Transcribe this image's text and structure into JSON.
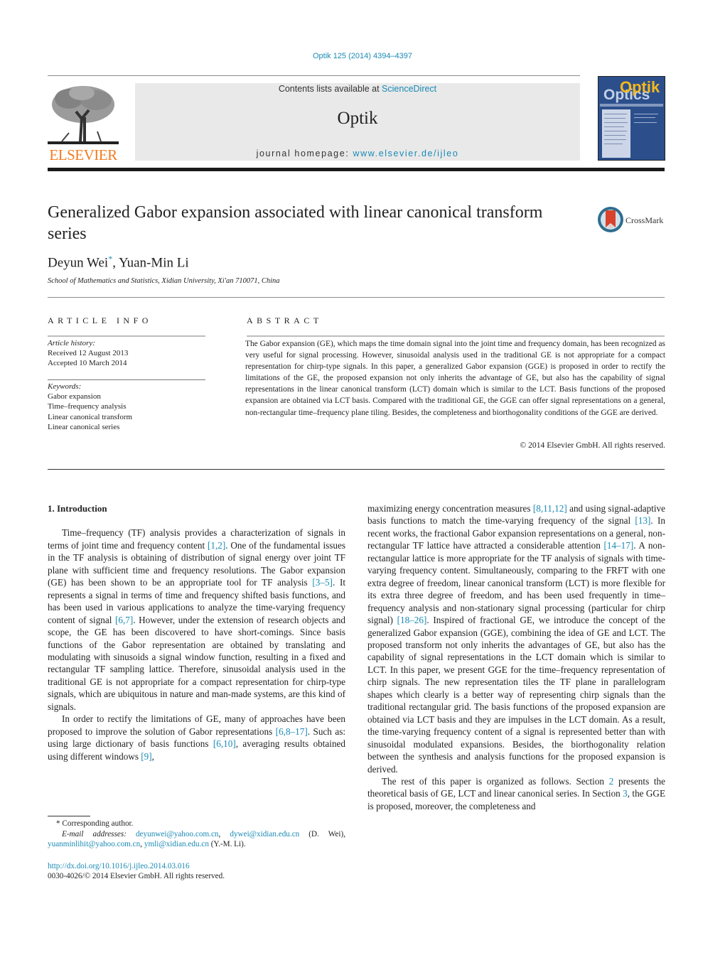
{
  "journal_ref": "Optik 125 (2014) 4394–4397",
  "header": {
    "publisher_logo_text": "ELSEVIER",
    "contents_prefix": "Contents lists available at ",
    "contents_link": "ScienceDirect",
    "journal_name": "Optik",
    "homepage_prefix": "journal homepage: ",
    "homepage_link": "www.elsevier.de/ijleo",
    "cover_title_1": "Optik",
    "cover_title_2": "Optics"
  },
  "article": {
    "title": "Generalized Gabor expansion associated with linear canonical transform series",
    "crossmark_label": "CrossMark",
    "authors": [
      {
        "name": "Deyun Wei",
        "mark": "*"
      },
      {
        "name": "Yuan-Min Li",
        "mark": ""
      }
    ],
    "author_separator": ", ",
    "affiliation": "School of Mathematics and Statistics, Xidian University, Xi'an 710071, China"
  },
  "article_info": {
    "label": "ARTICLE INFO",
    "history_label": "Article history:",
    "received": "Received 12 August 2013",
    "accepted": "Accepted 10 March 2014",
    "keywords_label": "Keywords:",
    "keywords": [
      "Gabor expansion",
      "Time–frequency analysis",
      "Linear canonical transform",
      "Linear canonical series"
    ]
  },
  "abstract": {
    "label": "ABSTRACT",
    "text": "The Gabor expansion (GE), which maps the time domain signal into the joint time and frequency domain, has been recognized as very useful for signal processing. However, sinusoidal analysis used in the traditional GE is not appropriate for a compact representation for chirp-type signals. In this paper, a generalized Gabor expansion (GGE) is proposed in order to rectify the limitations of the GE, the proposed expansion not only inherits the advantage of GE, but also has the capability of signal representations in the linear canonical transform (LCT) domain which is similar to the LCT. Basis functions of the proposed expansion are obtained via LCT basis. Compared with the traditional GE, the GGE can offer signal representations on a general, non-rectangular time–frequency plane tiling. Besides, the completeness and biorthogonality conditions of the GGE are derived.",
    "copyright": "© 2014 Elsevier GmbH. All rights reserved."
  },
  "body": {
    "section_heading": "1.  Introduction",
    "left_paragraphs": [
      [
        {
          "t": "Time–frequency (TF) analysis provides a characterization of signals in terms of joint time and frequency content "
        },
        {
          "ref": "[1,2]"
        },
        {
          "t": ". One of the fundamental issues in the TF analysis is obtaining of distribution of signal energy over joint TF plane with sufficient time and frequency resolutions. The Gabor expansion (GE) has been shown to be an appropriate tool for TF analysis "
        },
        {
          "ref": "[3–5]"
        },
        {
          "t": ". It represents a signal in terms of time and frequency shifted basis functions, and has been used in various applications to analyze the time-varying frequency content of signal "
        },
        {
          "ref": "[6,7]"
        },
        {
          "t": ". However, under the extension of research objects and scope, the GE has been discovered to have short-comings. Since basis functions of the Gabor representation are obtained by translating and modulating with sinusoids a signal window function, resulting in a fixed and rectangular TF sampling lattice. Therefore, sinusoidal analysis used in the traditional GE is not appropriate for a compact representation for chirp-type signals, which are ubiquitous in nature and man-made systems, are this kind of signals."
        }
      ],
      [
        {
          "t": "In order to rectify the limitations of GE, many of approaches have been proposed to improve the solution of Gabor representations "
        },
        {
          "ref": "[6,8–17]"
        },
        {
          "t": ". Such as: using large dictionary of basis functions "
        },
        {
          "ref": "[6,10]"
        },
        {
          "t": ", averaging results obtained using different windows "
        },
        {
          "ref": "[9]"
        },
        {
          "t": ","
        }
      ]
    ],
    "right_paragraphs": [
      [
        {
          "t": "maximizing energy concentration measures "
        },
        {
          "ref": "[8,11,12]"
        },
        {
          "t": " and using signal-adaptive basis functions to match the time-varying frequency of the signal "
        },
        {
          "ref": "[13]"
        },
        {
          "t": ". In recent works, the fractional Gabor expansion representations on a general, non-rectangular TF lattice have attracted a considerable attention "
        },
        {
          "ref": "[14–17]"
        },
        {
          "t": ". A non-rectangular lattice is more appropriate for the TF analysis of signals with time-varying frequency content. Simultaneously, comparing to the FRFT with one extra degree of freedom, linear canonical transform (LCT) is more flexible for its extra three degree of freedom, and has been used frequently in time–frequency analysis and non-stationary signal processing (particular for chirp signal) "
        },
        {
          "ref": "[18–26]"
        },
        {
          "t": ". Inspired of fractional GE, we introduce the concept of the generalized Gabor expansion (GGE), combining the idea of GE and LCT. The proposed transform not only inherits the advantages of GE, but also has the capability of signal representations in the LCT domain which is similar to LCT. In this paper, we present GGE for the time–frequency representation of chirp signals. The new representation tiles the TF plane in parallelogram shapes which clearly is a better way of representing chirp signals than the traditional rectangular grid. The basis functions of the proposed expansion are obtained via LCT basis and they are impulses in the LCT domain. As a result, the time-varying frequency content of a signal is represented better than with sinusoidal modulated expansions. Besides, the biorthogonality relation between the synthesis and analysis functions for the proposed expansion is derived."
        }
      ],
      [
        {
          "t": "The rest of this paper is organized as follows. Section "
        },
        {
          "ref": "2"
        },
        {
          "t": " presents the theoretical basis of GE, LCT and linear canonical series. In Section "
        },
        {
          "ref": "3"
        },
        {
          "t": ", the GGE is proposed, moreover, the completeness and"
        }
      ]
    ]
  },
  "footnotes": {
    "corresponding": "* Corresponding author.",
    "email_label": "E-mail addresses: ",
    "emails_wei": [
      "deyunwei@yahoo.com.cn",
      "dywei@xidian.edu.cn"
    ],
    "wei_suffix": " (D. Wei),",
    "emails_li": [
      "yuanminlihit@yahoo.com.cn",
      "ymli@xidian.edu.cn"
    ],
    "li_suffix": " (Y.-M. Li).",
    "doi": "http://dx.doi.org/10.1016/j.ijleo.2014.03.016",
    "issn_line": "0030-4026/© 2014 Elsevier GmbH. All rights reserved."
  }
}
